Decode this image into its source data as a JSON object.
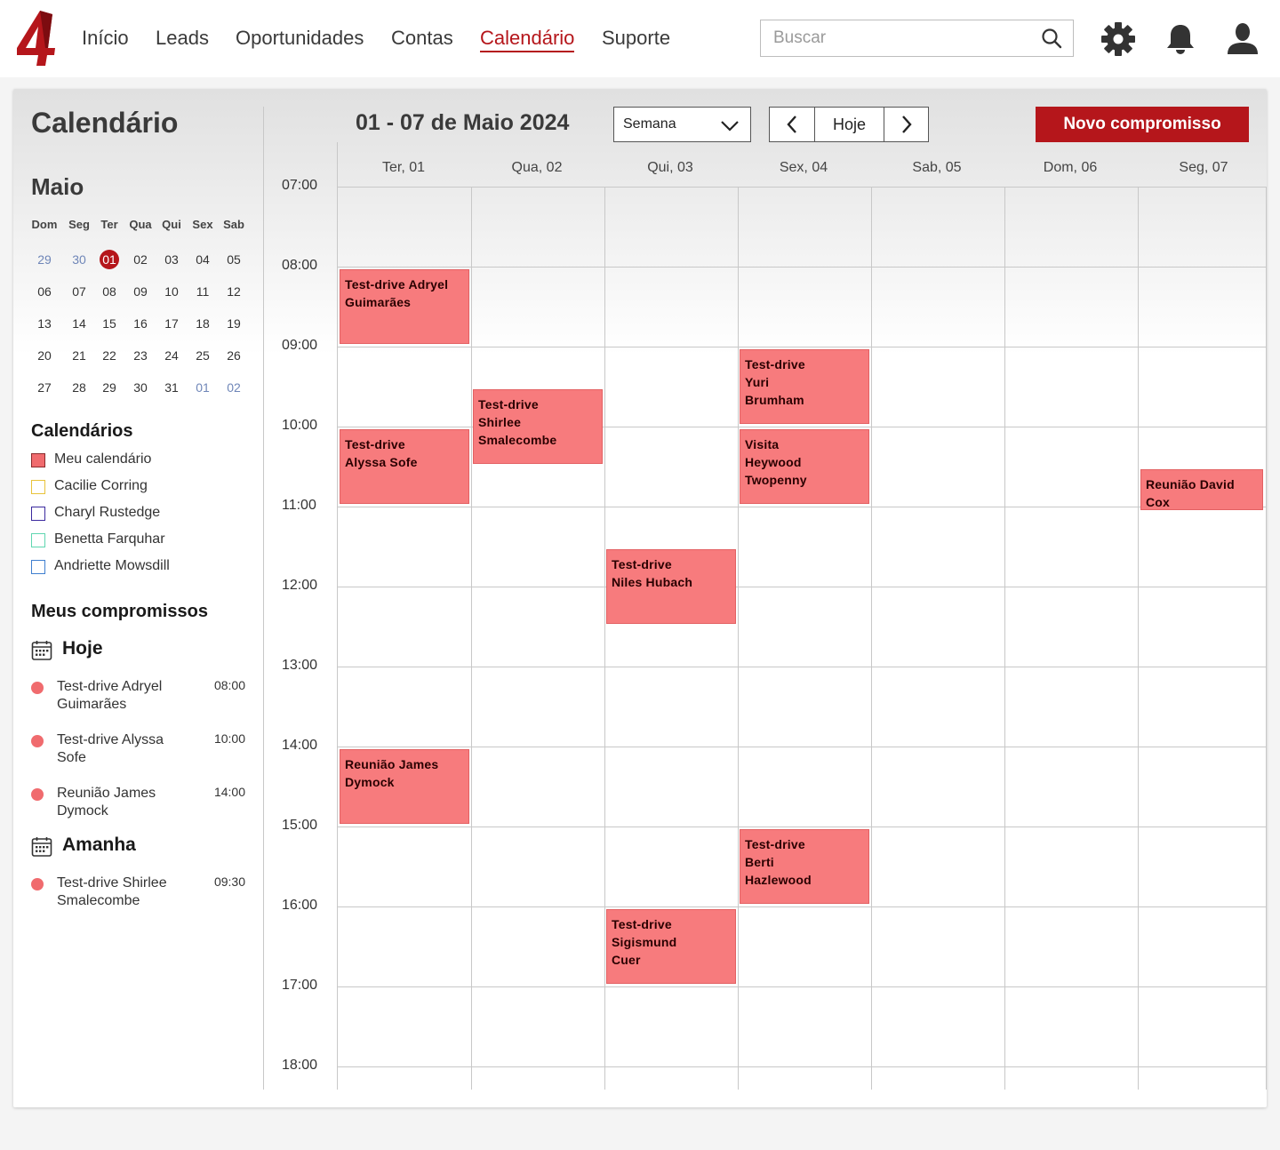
{
  "nav": {
    "items": [
      "Início",
      "Leads",
      "Oportunidades",
      "Contas",
      "Calendário",
      "Suporte"
    ],
    "active": "Calendário",
    "search_placeholder": "Buscar",
    "brand_color": "#b5161b"
  },
  "page": {
    "title": "Calendário"
  },
  "mini_calendar": {
    "month": "Maio",
    "weekdays": [
      "Dom",
      "Seg",
      "Ter",
      "Qua",
      "Qui",
      "Sex",
      "Sab"
    ],
    "weeks": [
      [
        "29",
        "30",
        "01",
        "02",
        "03",
        "04",
        "05"
      ],
      [
        "06",
        "07",
        "08",
        "09",
        "10",
        "11",
        "12"
      ],
      [
        "13",
        "14",
        "15",
        "16",
        "17",
        "18",
        "19"
      ],
      [
        "20",
        "21",
        "22",
        "23",
        "24",
        "25",
        "26"
      ],
      [
        "27",
        "28",
        "29",
        "30",
        "31",
        "01",
        "02"
      ]
    ],
    "today": "01"
  },
  "calendars": {
    "title": "Calendários",
    "items": [
      {
        "name": "Meu calendário",
        "color": "#f06b6e",
        "checked": true
      },
      {
        "name": "Cacilie Corring",
        "color": "#e8c33a",
        "checked": false
      },
      {
        "name": "Charyl Rustedge",
        "color": "#3b2a9e",
        "checked": false
      },
      {
        "name": "Benetta Farquhar",
        "color": "#5fd6b0",
        "checked": false
      },
      {
        "name": "Andriette Mowsdill",
        "color": "#3f7fcf",
        "checked": false
      }
    ]
  },
  "my_appointments": {
    "title": "Meus compromissos",
    "groups": [
      {
        "label": "Hoje",
        "items": [
          {
            "name": "Test-drive Adryel Guimarães",
            "time": "08:00"
          },
          {
            "name": "Test-drive Alyssa Sofe",
            "time": "10:00"
          },
          {
            "name": "Reunião James Dymock",
            "time": "14:00"
          }
        ]
      },
      {
        "label": "Amanha",
        "items": [
          {
            "name": "Test-drive Shirlee Smalecombe",
            "time": "09:30"
          }
        ]
      }
    ]
  },
  "toolbar": {
    "range_title": "01 - 07 de Maio 2024",
    "view_value": "Semana",
    "today_label": "Hoje",
    "new_button": "Novo compromisso"
  },
  "week": {
    "days": [
      "Ter, 01",
      "Qua, 02",
      "Qui, 03",
      "Sex, 04",
      "Sab, 05",
      "Dom, 06",
      "Seg, 07"
    ],
    "hours": [
      "07:00",
      "08:00",
      "09:00",
      "10:00",
      "11:00",
      "12:00",
      "13:00",
      "14:00",
      "15:00",
      "16:00",
      "17:00",
      "18:00"
    ],
    "event_color": "#f77b7d",
    "events": [
      {
        "day": 0,
        "start": "08:00",
        "end": "09:00",
        "lines": [
          "Test-drive Adryel",
          "Guimarães"
        ]
      },
      {
        "day": 0,
        "start": "10:00",
        "end": "11:00",
        "lines": [
          "Test-drive",
          "Alyssa Sofe"
        ]
      },
      {
        "day": 0,
        "start": "14:00",
        "end": "15:00",
        "lines": [
          "Reunião James",
          "Dymock"
        ]
      },
      {
        "day": 1,
        "start": "09:30",
        "end": "10:30",
        "lines": [
          "Test-drive",
          "Shirlee",
          "Smalecombe"
        ]
      },
      {
        "day": 2,
        "start": "11:30",
        "end": "12:30",
        "lines": [
          "Test-drive",
          "Niles Hubach"
        ]
      },
      {
        "day": 2,
        "start": "16:00",
        "end": "17:00",
        "lines": [
          "Test-drive",
          "Sigismund",
          "Cuer"
        ]
      },
      {
        "day": 3,
        "start": "09:00",
        "end": "10:00",
        "lines": [
          "Test-drive",
          "Yuri",
          "Brumham"
        ]
      },
      {
        "day": 3,
        "start": "10:00",
        "end": "11:00",
        "lines": [
          "Visita",
          "Heywood",
          "Twopenny"
        ]
      },
      {
        "day": 3,
        "start": "15:00",
        "end": "16:00",
        "lines": [
          "Test-drive",
          "Berti",
          "Hazlewood"
        ]
      },
      {
        "day": 6,
        "start": "10:30",
        "end": "11:00",
        "lines": [
          "Reunião David",
          "Cox"
        ]
      }
    ]
  }
}
